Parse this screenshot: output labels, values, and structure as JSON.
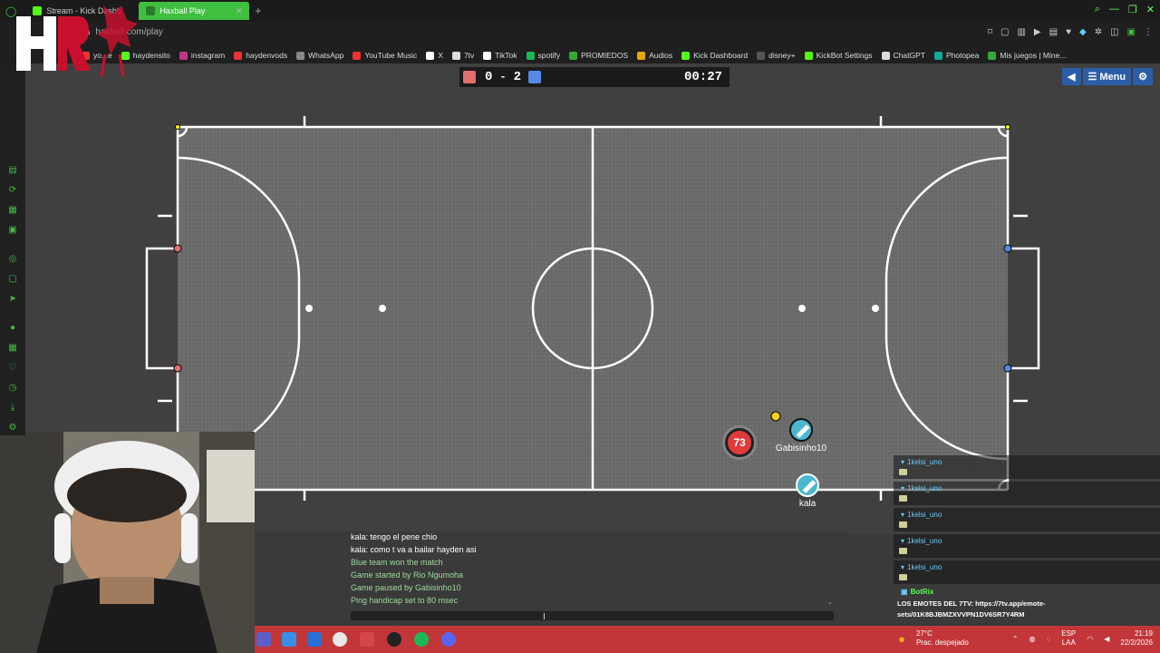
{
  "browser": {
    "tabs": [
      {
        "label": "Stream - Kick Dashb",
        "active": false
      },
      {
        "label": "Haxball Play",
        "active": true
      }
    ],
    "url": "haxball.com/play",
    "bookmarks": [
      {
        "label": "yo...e",
        "color": "#e33"
      },
      {
        "label": "haydensito",
        "color": "#53fc18"
      },
      {
        "label": "instagram",
        "color": "#c13584"
      },
      {
        "label": "haydenvods",
        "color": "#e33"
      },
      {
        "label": "WhatsApp",
        "color": "#888"
      },
      {
        "label": "YouTube Music",
        "color": "#e33"
      },
      {
        "label": "X",
        "color": "#fff"
      },
      {
        "label": "7tv",
        "color": "#ddd"
      },
      {
        "label": "TikTok",
        "color": "#fff"
      },
      {
        "label": "spotify",
        "color": "#1db954"
      },
      {
        "label": "PROMIEDOS",
        "color": "#3a3"
      },
      {
        "label": "Audios",
        "color": "#e9a500"
      },
      {
        "label": "Kick Dashboard",
        "color": "#53fc18"
      },
      {
        "label": "disney+",
        "color": "#555"
      },
      {
        "label": "KickBot Settings",
        "color": "#53fc18"
      },
      {
        "label": "ChatGPT",
        "color": "#ddd"
      },
      {
        "label": "Photopea",
        "color": "#1a9"
      },
      {
        "label": "Mis juegos | Mine...",
        "color": "#3a3"
      }
    ]
  },
  "game": {
    "score_red": "0",
    "score_separator": "-",
    "score_blue": "2",
    "timer": "00:27",
    "menu_label": "Menu",
    "players": [
      {
        "name": "",
        "number": "73",
        "team": "red"
      },
      {
        "name": "Gabisinho10",
        "number": "",
        "team": "blue"
      },
      {
        "name": "kala",
        "number": "",
        "team": "blue"
      }
    ]
  },
  "chat": {
    "lines": [
      {
        "text": "kala: tengo el pene chio",
        "kind": "player"
      },
      {
        "text": "kala: como t va a bailar hayden asi",
        "kind": "player"
      },
      {
        "text": "Blue team won the match",
        "kind": "system"
      },
      {
        "text": "Game started by Rio Ngumoha",
        "kind": "system"
      },
      {
        "text": "Game paused by Gabisinho10",
        "kind": "system"
      },
      {
        "text": "Ping handicap set to 80 msec",
        "kind": "system"
      }
    ]
  },
  "overlay_chat": {
    "users": [
      "1kelsi_uno",
      "1kelsi_uno",
      "1kelsi_uno",
      "1kelsi_uno",
      "1kelsi_uno"
    ],
    "bot_name": "BotRix",
    "bot_message": "LOS EMOTES DEL 7TV: https://7tv.app/emote-sets/01K8BJBMZXVVPN1DV6SR7Y4RM"
  },
  "taskbar": {
    "weather_temp": "27°C",
    "weather_desc": "Prac. despejado",
    "lang_top": "ESP",
    "lang_bottom": "LAA",
    "time": "21:19",
    "date": "22/2/2026"
  },
  "colors": {
    "red_team": "#e56e6e",
    "blue_team": "#5689e5",
    "accent_green": "#3fbf3f",
    "taskbar": "#c2363a"
  }
}
